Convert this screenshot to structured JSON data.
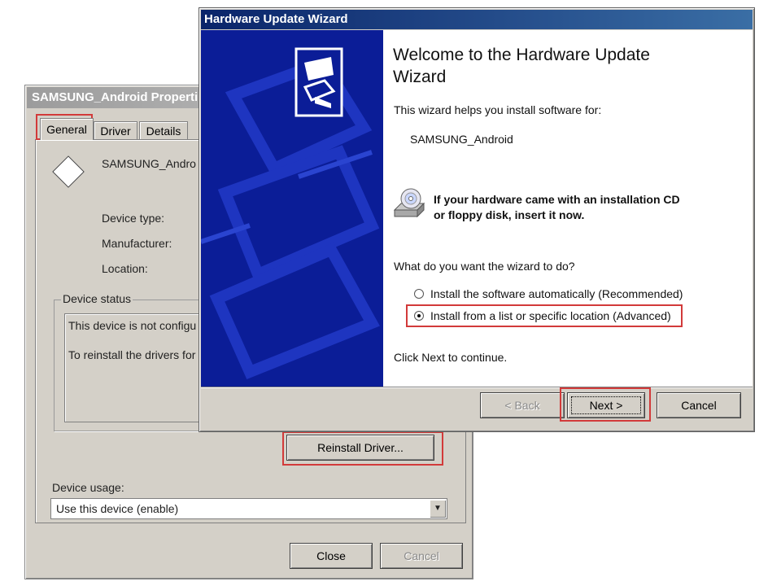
{
  "properties": {
    "title": "SAMSUNG_Android Properti",
    "tabs": [
      "General",
      "Driver",
      "Details"
    ],
    "device_name": "SAMSUNG_Andro",
    "fields": [
      "Device type:",
      "Manufacturer:",
      "Location:"
    ],
    "status_group": "Device status",
    "status_lines": [
      "This device is not configu",
      "To reinstall the drivers for"
    ],
    "reinstall_button": "Reinstall Driver...",
    "usage_label": "Device usage:",
    "usage_value": "Use this device (enable)",
    "close_button": "Close",
    "cancel_button": "Cancel"
  },
  "wizard": {
    "title": "Hardware Update Wizard",
    "heading_line1": "Welcome to the Hardware Update",
    "heading_line2": "Wizard",
    "intro": "This wizard helps you install software for:",
    "device": "SAMSUNG_Android",
    "cd_line1": "If your hardware came with an installation CD",
    "cd_line2": "or floppy disk, insert it now.",
    "question": "What do you want the wizard to do?",
    "options": [
      {
        "label": "Install the software automatically (Recommended)",
        "checked": false
      },
      {
        "label": "Install from a list or specific location (Advanced)",
        "checked": true
      }
    ],
    "continue_text": "Click Next to continue.",
    "back_button": "< Back",
    "next_button": "Next >",
    "cancel_button": "Cancel"
  },
  "colors": {
    "highlight": "#d23a3a",
    "banner": "#0b1d97",
    "titlebar": "#0a246a"
  }
}
